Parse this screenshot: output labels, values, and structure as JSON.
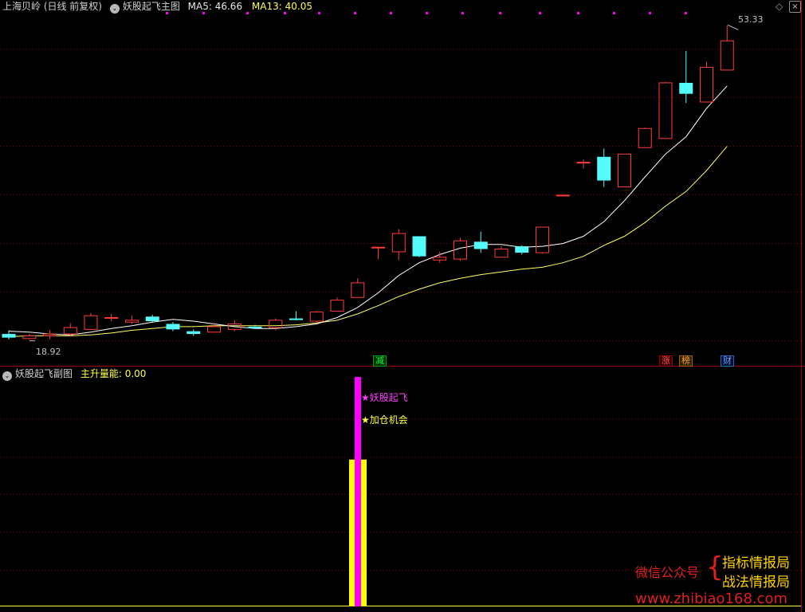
{
  "main_header": {
    "title": "上海贝岭 (日线 前复权)",
    "indicator": "妖股起飞主图",
    "ma5": "MA5: 46.66",
    "ma13": "MA13: 40.05"
  },
  "main_labels": {
    "high": "53.33",
    "low": "18.92"
  },
  "event_tags": [
    {
      "text": "减",
      "color": "#00c000"
    },
    {
      "text": "涨",
      "color": "#ff5050"
    },
    {
      "text": "榜",
      "color": "#ff9020"
    },
    {
      "text": "财",
      "color": "#4080ff"
    }
  ],
  "sub_header": {
    "indicator": "妖股起飞副图",
    "field": "主升量能: 0.00"
  },
  "sub_labels": {
    "signal1": "★妖股起飞",
    "signal2": "★加仓机会"
  },
  "watermark": {
    "left": "微信公众号",
    "line1": "指标情报局",
    "line2": "战法情报局",
    "url": "www.zhibiao168.com"
  },
  "icons": [
    "diamond-icon",
    "close-icon",
    "collapse-icon"
  ],
  "colors": {
    "up": "#ff3c3c",
    "down": "#54fcfc",
    "ma5": "#ffffff",
    "ma13": "#ffff60",
    "signal1": "#ff00ff",
    "signal2": "#ffff00",
    "grid": "#7a0000"
  },
  "chart_data": {
    "type": "candlestick",
    "price_range": [
      17.5,
      54.5
    ],
    "candles": [
      {
        "o": 19.5,
        "h": 19.9,
        "l": 18.9,
        "c": 19.1
      },
      {
        "o": 19.0,
        "h": 19.5,
        "l": 18.92,
        "c": 19.3
      },
      {
        "o": 19.3,
        "h": 19.9,
        "l": 18.95,
        "c": 19.5
      },
      {
        "o": 19.5,
        "h": 20.7,
        "l": 19.2,
        "c": 20.2
      },
      {
        "o": 20.0,
        "h": 21.8,
        "l": 19.9,
        "c": 21.5
      },
      {
        "o": 21.3,
        "h": 21.7,
        "l": 20.9,
        "c": 21.3
      },
      {
        "o": 20.8,
        "h": 21.5,
        "l": 20.6,
        "c": 21.0
      },
      {
        "o": 21.4,
        "h": 21.6,
        "l": 20.8,
        "c": 20.9
      },
      {
        "o": 20.6,
        "h": 20.8,
        "l": 19.8,
        "c": 20.0
      },
      {
        "o": 19.8,
        "h": 20.0,
        "l": 19.3,
        "c": 19.5
      },
      {
        "o": 19.7,
        "h": 20.7,
        "l": 19.7,
        "c": 20.3
      },
      {
        "o": 20.0,
        "h": 21.0,
        "l": 19.8,
        "c": 20.6
      },
      {
        "o": 20.3,
        "h": 20.5,
        "l": 20.1,
        "c": 20.2
      },
      {
        "o": 20.2,
        "h": 21.2,
        "l": 19.9,
        "c": 21.0
      },
      {
        "o": 21.2,
        "h": 22.0,
        "l": 21.0,
        "c": 21.1
      },
      {
        "o": 20.9,
        "h": 22.0,
        "l": 20.7,
        "c": 21.9
      },
      {
        "o": 22.0,
        "h": 23.5,
        "l": 22.0,
        "c": 23.2
      },
      {
        "o": 23.5,
        "h": 25.6,
        "l": 23.5,
        "c": 25.1
      },
      {
        "o": 29.0,
        "h": 29.0,
        "l": 27.7,
        "c": 29.0
      },
      {
        "o": 28.5,
        "h": 31.0,
        "l": 27.6,
        "c": 30.5
      },
      {
        "o": 30.2,
        "h": 30.2,
        "l": 27.9,
        "c": 28.0
      },
      {
        "o": 27.6,
        "h": 28.5,
        "l": 27.3,
        "c": 27.9
      },
      {
        "o": 27.7,
        "h": 30.0,
        "l": 27.5,
        "c": 29.7
      },
      {
        "o": 29.6,
        "h": 30.7,
        "l": 28.4,
        "c": 28.8
      },
      {
        "o": 27.9,
        "h": 29.1,
        "l": 27.9,
        "c": 28.8
      },
      {
        "o": 29.1,
        "h": 29.2,
        "l": 28.2,
        "c": 28.4
      },
      {
        "o": 28.4,
        "h": 31.2,
        "l": 28.3,
        "c": 31.2
      },
      {
        "o": 34.7,
        "h": 34.7,
        "l": 34.7,
        "c": 34.7
      },
      {
        "o": 38.3,
        "h": 38.6,
        "l": 37.6,
        "c": 38.3
      },
      {
        "o": 38.9,
        "h": 39.8,
        "l": 35.6,
        "c": 36.3
      },
      {
        "o": 35.6,
        "h": 39.2,
        "l": 35.6,
        "c": 39.2
      },
      {
        "o": 39.9,
        "h": 42.1,
        "l": 39.9,
        "c": 42.0
      },
      {
        "o": 40.9,
        "h": 47.1,
        "l": 40.9,
        "c": 47.0
      },
      {
        "o": 47.0,
        "h": 50.5,
        "l": 44.8,
        "c": 45.8
      },
      {
        "o": 44.9,
        "h": 49.3,
        "l": 44.9,
        "c": 48.7
      },
      {
        "o": 48.4,
        "h": 53.33,
        "l": 48.4,
        "c": 51.6
      }
    ],
    "ma5": [
      19.8,
      19.7,
      19.5,
      19.4,
      19.7,
      20.1,
      20.4,
      20.8,
      21.1,
      20.9,
      20.6,
      20.3,
      20.1,
      20.1,
      20.3,
      20.6,
      21.3,
      22.4,
      24.0,
      25.9,
      27.3,
      28.2,
      28.9,
      29.3,
      29.3,
      29.0,
      29.1,
      29.4,
      30.2,
      31.8,
      34.1,
      36.7,
      39.2,
      41.1,
      44.2,
      46.66
    ],
    "ma13": [
      19.2,
      19.3,
      19.3,
      19.3,
      19.4,
      19.6,
      19.9,
      20.1,
      20.3,
      20.3,
      20.4,
      20.4,
      20.4,
      20.4,
      20.5,
      20.7,
      21.0,
      21.7,
      22.6,
      23.6,
      24.4,
      25.1,
      25.6,
      26.0,
      26.3,
      26.6,
      26.8,
      27.3,
      28.0,
      29.2,
      30.2,
      31.7,
      33.5,
      35.1,
      37.4,
      40.05
    ],
    "sub_series": [
      {
        "name": "主升量能",
        "values": [
          0,
          0,
          0,
          0,
          0,
          0,
          0,
          0,
          0,
          0,
          0,
          0,
          0,
          0,
          0,
          0,
          0,
          0,
          0,
          0,
          0,
          0,
          0,
          0,
          0,
          0,
          0,
          0,
          0,
          0,
          0,
          0,
          0,
          0,
          0,
          0
        ],
        "last": 0.0
      }
    ],
    "sub_signal": {
      "bar_index": 17,
      "yellow_level": 0.64,
      "magenta_level": 1.0
    }
  }
}
